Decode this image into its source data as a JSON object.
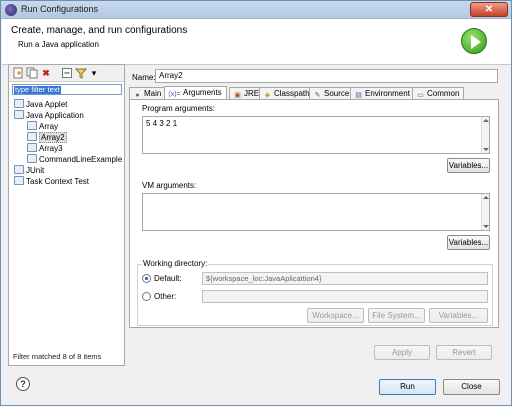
{
  "window": {
    "title": "Run Configurations",
    "close_glyph": "✕"
  },
  "header": {
    "title": "Create, manage, and run configurations",
    "subtitle": "Run a Java application",
    "badge_icon": "run-icon"
  },
  "toolbar": {
    "new_icon": "new-config-icon",
    "duplicate_icon": "duplicate-icon",
    "delete_glyph": "✖",
    "collapse_icon": "collapse-all-icon",
    "filter_icon": "filter-icon",
    "dropdown_glyph": "▾"
  },
  "filter": {
    "value": "type filter text"
  },
  "tree": {
    "items": [
      {
        "label": "Java Applet",
        "icon": "java-applet-icon"
      },
      {
        "label": "Java Application",
        "icon": "java-application-icon"
      },
      {
        "label": "Array",
        "icon": "config-icon"
      },
      {
        "label": "Array2",
        "icon": "config-icon"
      },
      {
        "label": "Array3",
        "icon": "config-icon"
      },
      {
        "label": "CommandLineExample",
        "icon": "config-icon"
      },
      {
        "label": "JUnit",
        "icon": "junit-icon"
      },
      {
        "label": "Task Context Test",
        "icon": "junit-icon"
      }
    ],
    "status": "Filter matched 8 of 8 items"
  },
  "config": {
    "name_label": "Name:",
    "name_value": "Array2"
  },
  "tabs": [
    {
      "label": "Main",
      "icon": "main-tab-icon",
      "glyph": "●"
    },
    {
      "label": "Arguments",
      "icon": "arguments-tab-icon",
      "glyph": "(x)="
    },
    {
      "label": "JRE",
      "icon": "jre-tab-icon",
      "glyph": "▣"
    },
    {
      "label": "Classpath",
      "icon": "classpath-tab-icon",
      "glyph": "◈"
    },
    {
      "label": "Source",
      "icon": "source-tab-icon",
      "glyph": "✎"
    },
    {
      "label": "Environment",
      "icon": "environment-tab-icon",
      "glyph": "▤"
    },
    {
      "label": "Common",
      "icon": "common-tab-icon",
      "glyph": "▭"
    }
  ],
  "arguments": {
    "program_label": "Program arguments:",
    "program_value": "5 4 3 2 1",
    "variables_label": "Variables...",
    "vm_label": "VM arguments:",
    "vm_value": "",
    "vm_variables_label": "Variables..."
  },
  "working_dir": {
    "label": "Working directory:",
    "default_label": "Default:",
    "default_value": "${workspace_loc:JavaAplicattion4}",
    "other_label": "Other:",
    "other_value": "",
    "workspace_label": "Workspace...",
    "filesystem_label": "File System...",
    "variables_label": "Variables..."
  },
  "footer": {
    "apply_label": "Apply",
    "revert_label": "Revert",
    "help_glyph": "?",
    "run_label": "Run",
    "close_label": "Close"
  }
}
